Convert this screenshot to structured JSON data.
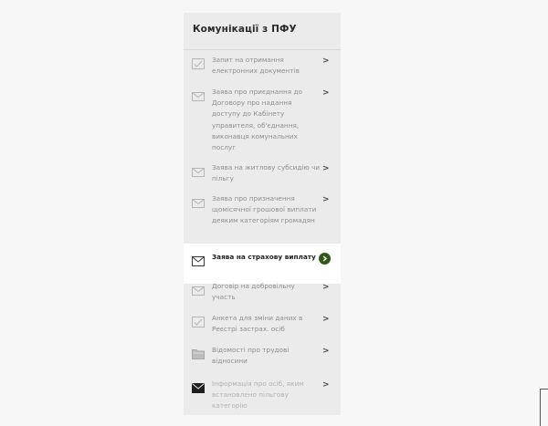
{
  "panel": {
    "title": "Комунікації з ПФУ",
    "items": [
      {
        "label": "Запит на отримання електронних документів",
        "icon": "checked-form-icon"
      },
      {
        "label": "Заява про приєднання до Договору про надання доступу до Кабінету управителя, об'єднання, виконавця комунальних послуг",
        "icon": "open-envelope-icon"
      },
      {
        "label": "Заява на житлову субсидію чи пільгу",
        "icon": "open-envelope-icon"
      },
      {
        "label": "Заява про призначення щомісячної грошової виплати деяким категоріям громадян",
        "icon": "open-envelope-icon"
      },
      {
        "label": "Заява на страхову виплату",
        "icon": "envelope-icon",
        "active": true
      },
      {
        "label": "Договір на добровільну участь",
        "icon": "open-envelope-icon"
      },
      {
        "label": "Анкета для зміни даних в Реєстрі застрах. осіб",
        "icon": "checked-form-icon"
      },
      {
        "label": "Відомості про трудові відносини",
        "icon": "folder-icon"
      },
      {
        "label": "Інформація про осіб, яким встановлено пільгову категорію",
        "icon": "filled-envelope-icon",
        "muted": true
      }
    ],
    "chevron": ">",
    "active_color": "#2f5a16"
  }
}
